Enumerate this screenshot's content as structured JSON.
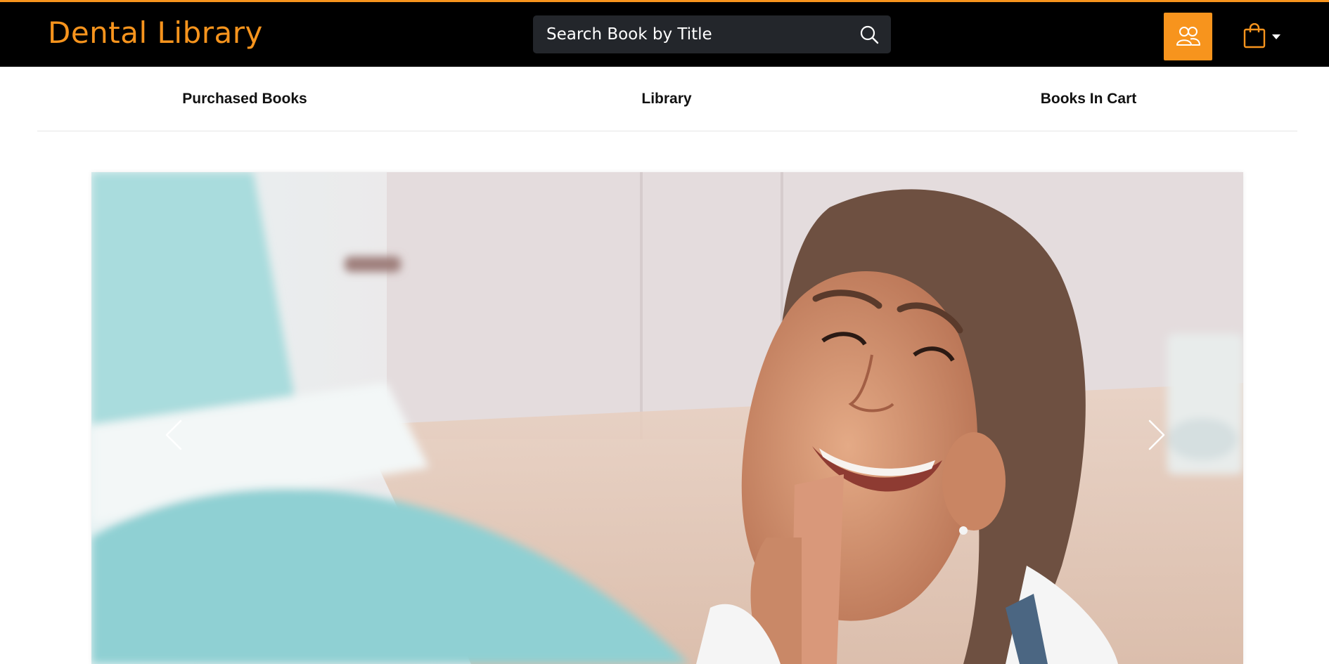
{
  "header": {
    "brand": "Dental Library",
    "search": {
      "placeholder": "Search Book by Title"
    },
    "icons": {
      "search": "search-icon",
      "user": "users-icon",
      "cart": "shopping-bag-icon",
      "dropdown": "caret-down-icon"
    },
    "accent_color": "#f7941d"
  },
  "nav": {
    "items": [
      {
        "label": "Purchased Books"
      },
      {
        "label": "Library"
      },
      {
        "label": "Books In Cart"
      }
    ]
  },
  "carousel": {
    "image": "smiling-girl-dental-chair-photo",
    "controls": {
      "prev": "chevron-left-icon",
      "next": "chevron-right-icon"
    }
  }
}
